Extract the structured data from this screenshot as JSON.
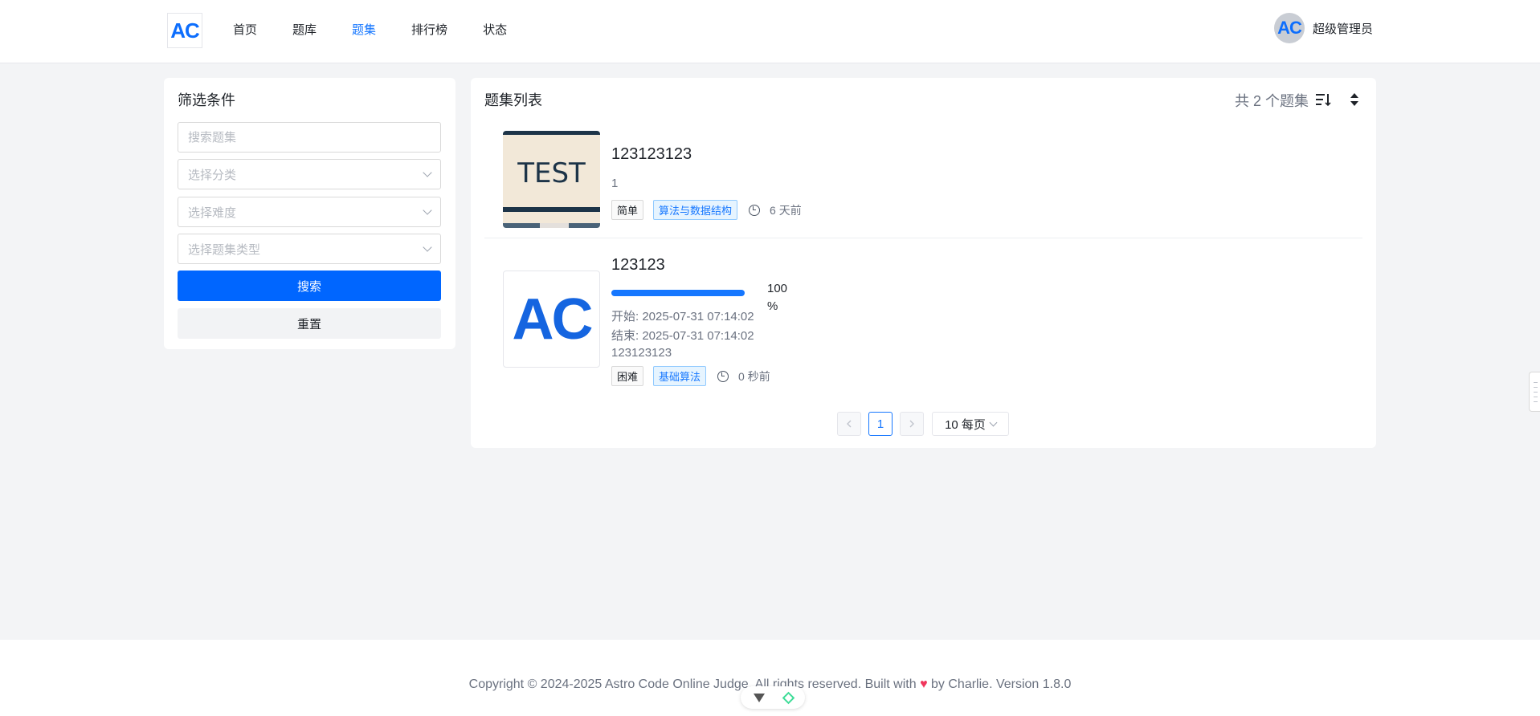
{
  "header": {
    "logo_text": "AC",
    "nav": [
      {
        "label": "首页",
        "active": false
      },
      {
        "label": "题库",
        "active": false
      },
      {
        "label": "题集",
        "active": true
      },
      {
        "label": "排行榜",
        "active": false
      },
      {
        "label": "状态",
        "active": false
      }
    ],
    "user": {
      "avatar_text": "AC",
      "name": "超级管理员"
    }
  },
  "filter": {
    "title": "筛选条件",
    "search_placeholder": "搜索题集",
    "category_placeholder": "选择分类",
    "difficulty_placeholder": "选择难度",
    "type_placeholder": "选择题集类型",
    "search_button": "搜索",
    "reset_button": "重置"
  },
  "list": {
    "title": "题集列表",
    "total_text": "共 2 个题集",
    "items": [
      {
        "thumb_text": "TEST",
        "title": "123123123",
        "desc": "1",
        "difficulty": "简单",
        "tag": "算法与数据结构",
        "time_ago": "6 天前"
      },
      {
        "thumb_text": "AC",
        "title": "123123",
        "progress_percent": 100,
        "progress_label": "100 %",
        "start": "开始: 2025-07-31 07:14:02",
        "end": "结束: 2025-07-31 07:14:02",
        "desc": "123123123",
        "difficulty": "困难",
        "tag": "基础算法",
        "time_ago": "0 秒前"
      }
    ],
    "pagination": {
      "current_page": "1",
      "page_size": "10 每页"
    }
  },
  "footer": {
    "text_before": "Copyright © 2024-2025 Astro Code Online Judge. All rights reserved. Built with",
    "heart": "♥",
    "text_after": "by Charlie. Version 1.8.0"
  },
  "colors": {
    "accent": "#1677ff",
    "primary_button": "#0066ff",
    "heart": "#f0365c"
  }
}
